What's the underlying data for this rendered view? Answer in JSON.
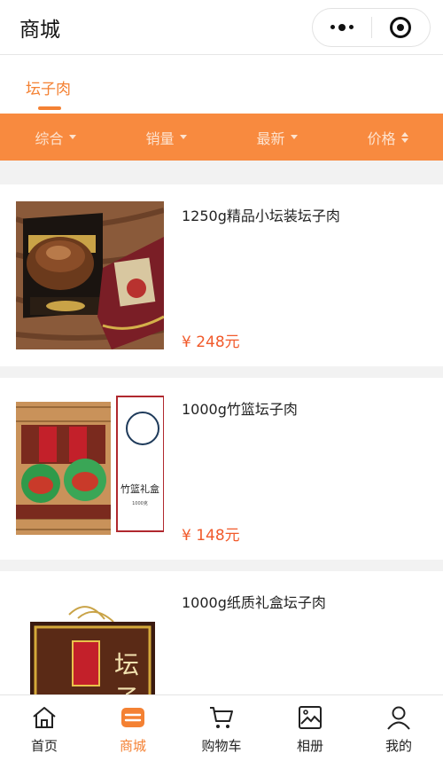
{
  "header": {
    "title": "商城"
  },
  "category_tabs": [
    {
      "label": "坛子肉",
      "active": true
    }
  ],
  "filters": [
    {
      "label": "综合",
      "icon": "caret-down-icon"
    },
    {
      "label": "销量",
      "icon": "caret-down-icon"
    },
    {
      "label": "最新",
      "icon": "caret-down-icon"
    },
    {
      "label": "价格",
      "icon": "sort-icon"
    }
  ],
  "products": [
    {
      "name": "1250g精品小坛装坛子肉",
      "price": "¥ 248元",
      "image": "jar-giftbox-photo"
    },
    {
      "name": "1000g竹篮坛子肉",
      "price": "¥ 148元",
      "image": "bamboo-basket-photo",
      "image_text": [
        "竹篮礼盒",
        "1000克"
      ]
    },
    {
      "name": "1000g纸质礼盒坛子肉",
      "price": "",
      "image": "paper-giftbox-photo",
      "image_text": [
        "坛",
        "子"
      ]
    }
  ],
  "tabbar": [
    {
      "label": "首页",
      "icon": "home-icon",
      "active": false
    },
    {
      "label": "商城",
      "icon": "store-icon",
      "active": true
    },
    {
      "label": "购物车",
      "icon": "cart-icon",
      "active": false
    },
    {
      "label": "相册",
      "icon": "album-icon",
      "active": false
    },
    {
      "label": "我的",
      "icon": "user-icon",
      "active": false
    }
  ],
  "colors": {
    "accent": "#f48133",
    "filter_bar": "#f88a3f",
    "price": "#f15a2b",
    "background": "#f2f2f2"
  }
}
